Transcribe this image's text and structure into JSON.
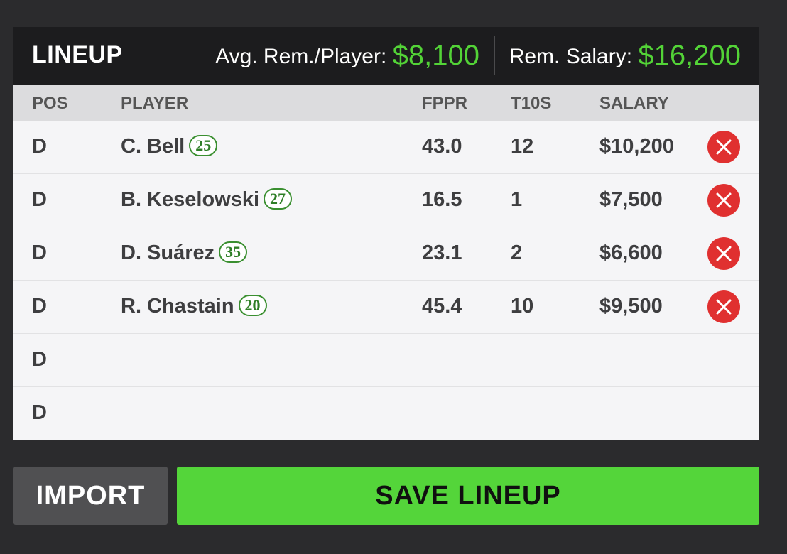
{
  "header": {
    "title": "LINEUP",
    "avg_label": "Avg. Rem./Player: ",
    "avg_value": "$8,100",
    "rem_label": "Rem. Salary: ",
    "rem_value": "$16,200"
  },
  "columns": {
    "pos": "POS",
    "player": "PLAYER",
    "fppr": "FPPR",
    "t10s": "T10S",
    "salary": "SALARY"
  },
  "rows": [
    {
      "pos": "D",
      "player": "C. Bell",
      "number": "25",
      "fppr": "43.0",
      "t10s": "12",
      "salary": "$10,200"
    },
    {
      "pos": "D",
      "player": "B. Keselowski",
      "number": "27",
      "fppr": "16.5",
      "t10s": "1",
      "salary": "$7,500"
    },
    {
      "pos": "D",
      "player": "D. Suárez",
      "number": "35",
      "fppr": "23.1",
      "t10s": "2",
      "salary": "$6,600"
    },
    {
      "pos": "D",
      "player": "R. Chastain",
      "number": "20",
      "fppr": "45.4",
      "t10s": "10",
      "salary": "$9,500"
    },
    {
      "pos": "D"
    },
    {
      "pos": "D"
    }
  ],
  "buttons": {
    "import": "IMPORT",
    "save": "SAVE LINEUP"
  },
  "icons": {
    "remove": "close-icon"
  },
  "colors": {
    "accent_green": "#53d337",
    "remove_red": "#e03030",
    "save_green": "#54d53a"
  }
}
